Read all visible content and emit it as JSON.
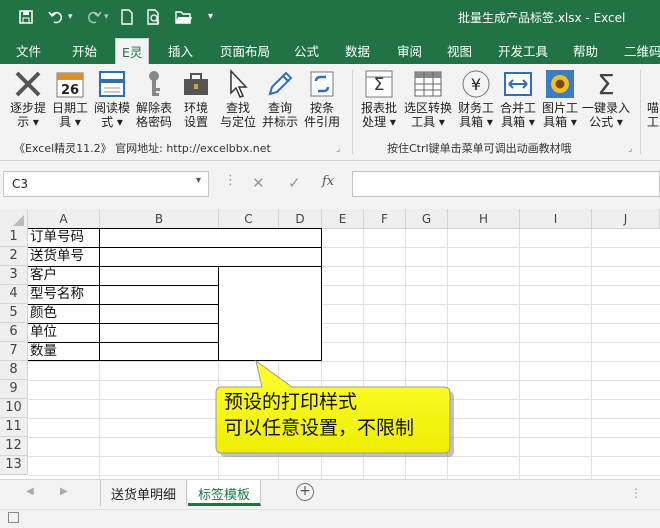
{
  "window": {
    "title": "批量生成产品标签.xlsx  -  Excel"
  },
  "quick_access": {
    "save": "save",
    "undo": "undo",
    "redo": "redo",
    "more": "▾"
  },
  "tabs": [
    "文件",
    "开始",
    "E灵",
    "插入",
    "页面布局",
    "公式",
    "数据",
    "审阅",
    "视图",
    "开发工具",
    "帮助",
    "二维码"
  ],
  "active_tab": "E灵",
  "ribbon": {
    "left_buttons": [
      {
        "label": "逐步提\n示 ▾",
        "icon": "x-tools-icon"
      },
      {
        "label": "日期工\n具 ▾",
        "icon": "calendar-icon",
        "badge": "26"
      },
      {
        "label": "阅读模\n式 ▾",
        "icon": "reading-mode-icon"
      },
      {
        "label": "解除表\n格密码",
        "icon": "key-icon"
      },
      {
        "label": "环境\n设置",
        "icon": "toolbox-icon"
      },
      {
        "label": "查找\n与定位",
        "icon": "cursor-icon"
      },
      {
        "label": "查询\n并标示",
        "icon": "pen-icon"
      },
      {
        "label": "按条\n件引用",
        "icon": "link-icon"
      }
    ],
    "right_buttons": [
      {
        "label": "报表批\n处理 ▾",
        "icon": "sigma-table-icon"
      },
      {
        "label": "选区转换\n工具 ▾",
        "icon": "table-icon"
      },
      {
        "label": "财务工\n具箱 ▾",
        "icon": "yen-icon"
      },
      {
        "label": "合并工\n具箱 ▾",
        "icon": "merge-icon"
      },
      {
        "label": "图片工\n具箱 ▾",
        "icon": "flower-icon"
      },
      {
        "label": "一键录入\n公式 ▾",
        "icon": "sigma-icon"
      }
    ],
    "cut_button": {
      "label": "喵\n工",
      "icon": "truncated-icon"
    },
    "left_caption": "《Excel精灵11.2》 官网地址: http://excelbbx.net",
    "right_caption": "按住Ctrl键单击菜单可调出动画教材哦"
  },
  "formula_bar": {
    "name_box": "C3",
    "fx": "fx",
    "formula": ""
  },
  "columns": [
    "A",
    "B",
    "C",
    "D",
    "E",
    "F",
    "G",
    "H",
    "I",
    "J"
  ],
  "rows": [
    "1",
    "2",
    "3",
    "4",
    "5",
    "6",
    "7",
    "8",
    "9",
    "10",
    "11",
    "12",
    "13"
  ],
  "cells": {
    "A1": "订单号码",
    "A2": "送货单号",
    "A3": "客户",
    "A4": "型号名称",
    "A5": "颜色",
    "A6": "单位",
    "A7": "数量"
  },
  "callout": {
    "line1": "预设的打印样式",
    "line2": "可以任意设置，不限制"
  },
  "sheets": [
    "送货单明细",
    "标签模板"
  ],
  "active_sheet": "标签模板",
  "colors": {
    "excel_green": "#217346",
    "callout_fill": "#ffff00"
  }
}
